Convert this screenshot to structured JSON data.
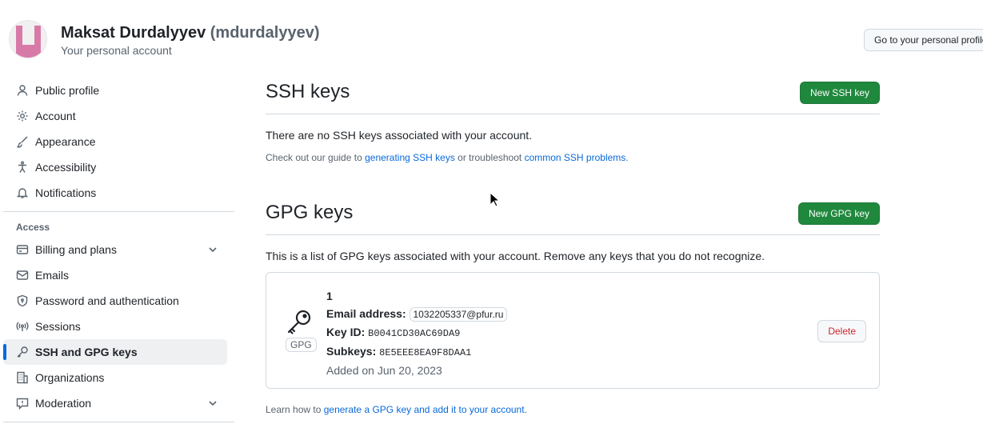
{
  "header": {
    "name": "Maksat Durdalyyev",
    "login": "(mdurdalyyev)",
    "subtitle": "Your personal account",
    "profile_button": "Go to your personal profile"
  },
  "sidebar": {
    "items": [
      {
        "label": "Public profile",
        "icon": "person-icon"
      },
      {
        "label": "Account",
        "icon": "gear-icon"
      },
      {
        "label": "Appearance",
        "icon": "paintbrush-icon"
      },
      {
        "label": "Accessibility",
        "icon": "accessibility-icon"
      },
      {
        "label": "Notifications",
        "icon": "bell-icon"
      }
    ],
    "access_title": "Access",
    "access_items": [
      {
        "label": "Billing and plans",
        "icon": "credit-card-icon"
      },
      {
        "label": "Emails",
        "icon": "mail-icon"
      },
      {
        "label": "Password and authentication",
        "icon": "shield-lock-icon"
      },
      {
        "label": "Sessions",
        "icon": "broadcast-icon"
      },
      {
        "label": "SSH and GPG keys",
        "icon": "key-icon"
      },
      {
        "label": "Organizations",
        "icon": "organization-icon"
      },
      {
        "label": "Moderation",
        "icon": "report-icon"
      }
    ]
  },
  "ssh": {
    "title": "SSH keys",
    "new_button": "New SSH key",
    "empty_message": "There are no SSH keys associated with your account.",
    "guide_prefix": "Check out our guide to",
    "guide_link": "generating SSH keys",
    "guide_middle": "or troubleshoot",
    "problems_link": "common SSH problems",
    "guide_suffix": "."
  },
  "gpg": {
    "title": "GPG keys",
    "new_button": "New GPG key",
    "list_message": "This is a list of GPG keys associated with your account. Remove any keys that you do not recognize.",
    "key": {
      "badge": "GPG",
      "name": "1",
      "email_label": "Email address:",
      "email": "1032205337@pfur.ru",
      "keyid_label": "Key ID:",
      "keyid": "B0041CD30AC69DA9",
      "subkeys_label": "Subkeys:",
      "subkeys": "8E5EEE8EA9F8DAA1",
      "added": "Added on Jun 20, 2023",
      "delete_button": "Delete"
    },
    "learn_prefix": "Learn how to",
    "learn_link": "generate a GPG key and add it to your account",
    "learn_suffix": "."
  }
}
